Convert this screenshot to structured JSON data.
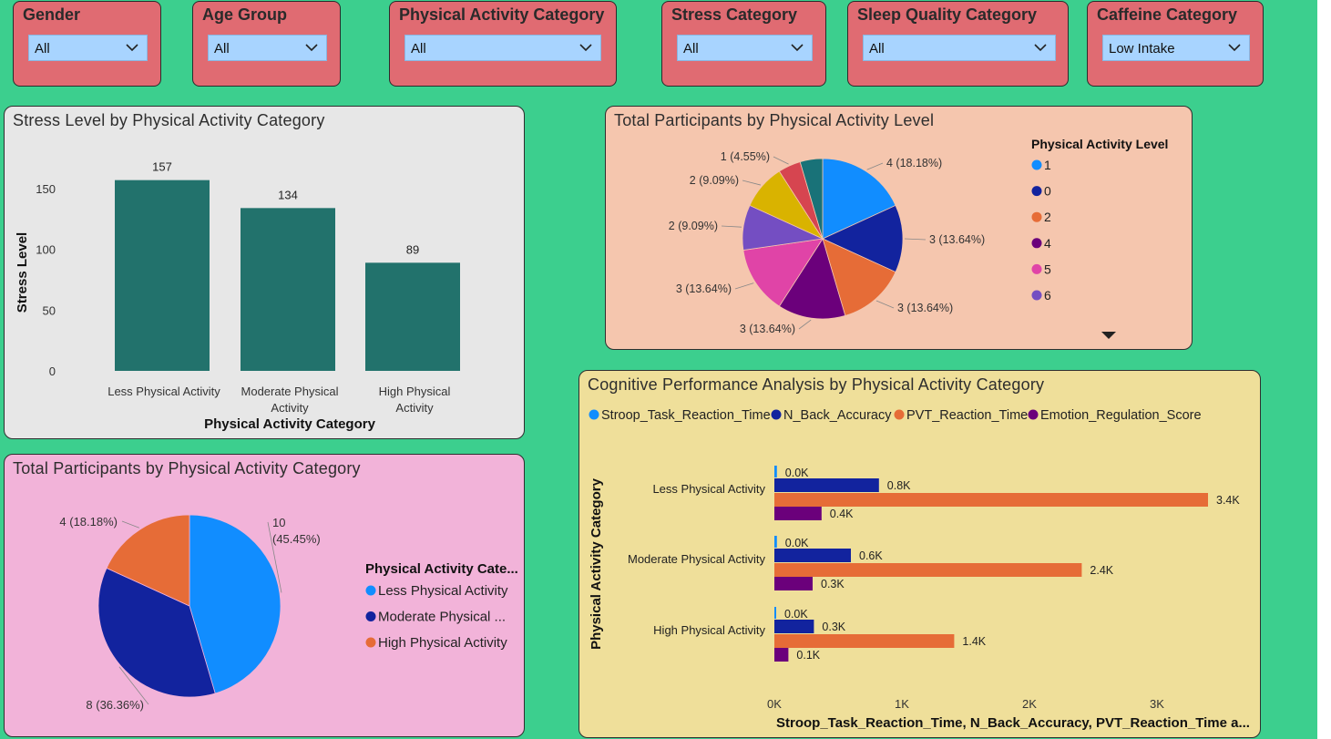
{
  "slicers": [
    {
      "title": "Gender",
      "value": "All"
    },
    {
      "title": "Age Group",
      "value": "All"
    },
    {
      "title": "Physical Activity Category",
      "value": "All"
    },
    {
      "title": "Stress Category",
      "value": "All"
    },
    {
      "title": "Sleep Quality Category",
      "value": "All"
    },
    {
      "title": "Caffeine Category",
      "value": "Low Intake"
    }
  ],
  "colors": {
    "background": "#3ccf8e",
    "slicer": "#e06b72",
    "bar": "#22726c",
    "blue": "#118dff",
    "navy": "#12239e",
    "orange": "#e66c37",
    "purple": "#6b007b",
    "pink": "#e044a7",
    "violet": "#744ec2",
    "gold": "#d9b300",
    "red": "#d64550",
    "teal": "#197278"
  },
  "stress_chart": {
    "title": "Stress Level by Physical Activity Category",
    "chart_data": {
      "type": "bar",
      "categories": [
        "Less Physical Activity",
        "Moderate Physical Activity",
        "High Physical Activity"
      ],
      "category_lines": [
        [
          "Less Physical Activity"
        ],
        [
          "Moderate Physical",
          "Activity"
        ],
        [
          "High Physical",
          "Activity"
        ]
      ],
      "values": [
        157,
        134,
        89
      ],
      "data_labels": [
        "157",
        "134",
        "89"
      ],
      "xlabel": "Physical Activity Category",
      "ylabel": "Stress Level",
      "yticks": [
        0,
        50,
        100,
        150
      ],
      "ylim": [
        0,
        165
      ]
    }
  },
  "activity_level_pie": {
    "title": "Total Participants by Physical Activity Level",
    "legend_title": "Physical Activity Level",
    "legend": [
      {
        "label": "1",
        "color": "#118dff"
      },
      {
        "label": "0",
        "color": "#12239e"
      },
      {
        "label": "2",
        "color": "#e66c37"
      },
      {
        "label": "4",
        "color": "#6b007b"
      },
      {
        "label": "5",
        "color": "#e044a7"
      },
      {
        "label": "6",
        "color": "#744ec2"
      }
    ],
    "chart_data": {
      "type": "pie",
      "slices": [
        {
          "value": 4,
          "label": "4 (18.18%)",
          "color": "#118dff"
        },
        {
          "value": 3,
          "label": "3 (13.64%)",
          "color": "#12239e"
        },
        {
          "value": 3,
          "label": "3 (13.64%)",
          "color": "#e66c37"
        },
        {
          "value": 3,
          "label": "3 (13.64%)",
          "color": "#6b007b"
        },
        {
          "value": 3,
          "label": "3 (13.64%)",
          "color": "#e044a7"
        },
        {
          "value": 2,
          "label": "2 (9.09%)",
          "color": "#744ec2"
        },
        {
          "value": 2,
          "label": "2 (9.09%)",
          "color": "#d9b300"
        },
        {
          "value": 1,
          "label": "1 (4.55%)",
          "color": "#d64550"
        },
        {
          "value": 1,
          "label": "",
          "color": "#197278"
        }
      ]
    }
  },
  "category_pie": {
    "title": "Total Participants by Physical Activity Category",
    "legend_title": "Physical Activity Cate...",
    "legend": [
      {
        "label": "Less Physical Activity",
        "color": "#118dff"
      },
      {
        "label": "Moderate Physical ...",
        "color": "#12239e"
      },
      {
        "label": "High Physical Activity",
        "color": "#e66c37"
      }
    ],
    "chart_data": {
      "type": "pie",
      "slices": [
        {
          "value": 10,
          "label_lines": [
            "10",
            "(45.45%)"
          ],
          "color": "#118dff"
        },
        {
          "value": 8,
          "label_lines": [
            "8 (36.36%)"
          ],
          "color": "#12239e"
        },
        {
          "value": 4,
          "label_lines": [
            "4 (18.18%)"
          ],
          "color": "#e66c37"
        }
      ]
    }
  },
  "cognitive_chart": {
    "title": "Cognitive Performance Analysis by Physical Activity Category",
    "chart_data": {
      "type": "bar",
      "orientation": "horizontal",
      "categories": [
        "Less Physical Activity",
        "Moderate Physical Activity",
        "High Physical Activity"
      ],
      "series": [
        {
          "name": "Stroop_Task_Reaction_Time",
          "color": "#118dff",
          "values": [
            0.02,
            0.02,
            0.01
          ],
          "labels": [
            "0.0K",
            "0.0K",
            "0.0K"
          ]
        },
        {
          "name": "N_Back_Accuracy",
          "color": "#12239e",
          "values": [
            0.82,
            0.6,
            0.31
          ],
          "labels": [
            "0.8K",
            "0.6K",
            "0.3K"
          ]
        },
        {
          "name": "PVT_Reaction_Time",
          "color": "#e66c37",
          "values": [
            3.4,
            2.41,
            1.41
          ],
          "labels": [
            "3.4K",
            "2.4K",
            "1.4K"
          ]
        },
        {
          "name": "Emotion_Regulation_Score",
          "color": "#6b007b",
          "values": [
            0.37,
            0.3,
            0.11
          ],
          "labels": [
            "0.4K",
            "0.3K",
            "0.1K"
          ]
        }
      ],
      "xticks": [
        "0K",
        "1K",
        "2K",
        "3K"
      ],
      "xlim": [
        0,
        3.5
      ],
      "xlabel": "Stroop_Task_Reaction_Time, N_Back_Accuracy, PVT_Reaction_Time a...",
      "ylabel": "Physical Activity Category"
    }
  }
}
